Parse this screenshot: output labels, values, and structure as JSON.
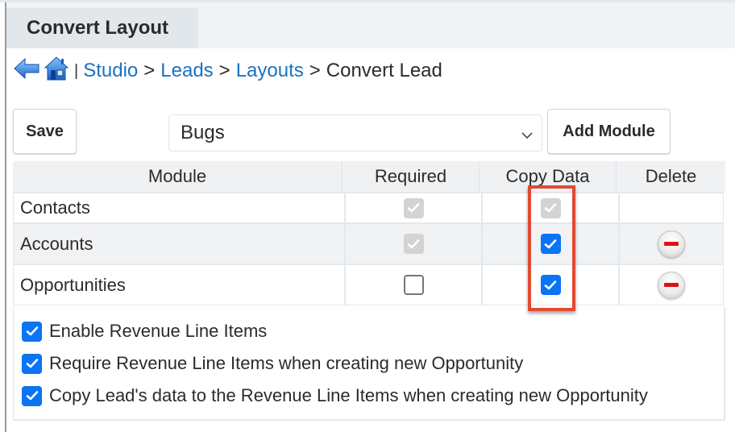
{
  "tab": {
    "title": "Convert Layout"
  },
  "breadcrumb": {
    "back_icon": "back-arrow-icon",
    "home_icon": "home-icon",
    "separator_pipe": "|",
    "items": [
      {
        "label": "Studio",
        "link": true
      },
      {
        "label": "Leads",
        "link": true
      },
      {
        "label": "Layouts",
        "link": true
      },
      {
        "label": "Convert Lead",
        "link": false
      }
    ],
    "separator": ">"
  },
  "toolbar": {
    "save_label": "Save",
    "module_select_value": "Bugs",
    "add_module_label": "Add Module"
  },
  "table": {
    "headers": [
      "Module",
      "Required",
      "Copy Data",
      "Delete"
    ],
    "rows": [
      {
        "module": "Contacts",
        "required": "checked-disabled",
        "copy_data": "checked-disabled",
        "deletable": false
      },
      {
        "module": "Accounts",
        "required": "checked-disabled",
        "copy_data": "checked",
        "deletable": true
      },
      {
        "module": "Opportunities",
        "required": "unchecked",
        "copy_data": "checked",
        "deletable": true
      }
    ]
  },
  "options": [
    {
      "label": "Enable Revenue Line Items",
      "checked": true
    },
    {
      "label": "Require Revenue Line Items when creating new Opportunity",
      "checked": true
    },
    {
      "label": "Copy Lead's data to the Revenue Line Items when creating new Opportunity",
      "checked": true
    }
  ],
  "colors": {
    "link": "#1a73c0",
    "checkbox_checked": "#0a74f5",
    "checkbox_disabled": "#d3d3d3",
    "highlight_annotation": "#e04a32",
    "delete_minus": "#e0101a"
  }
}
